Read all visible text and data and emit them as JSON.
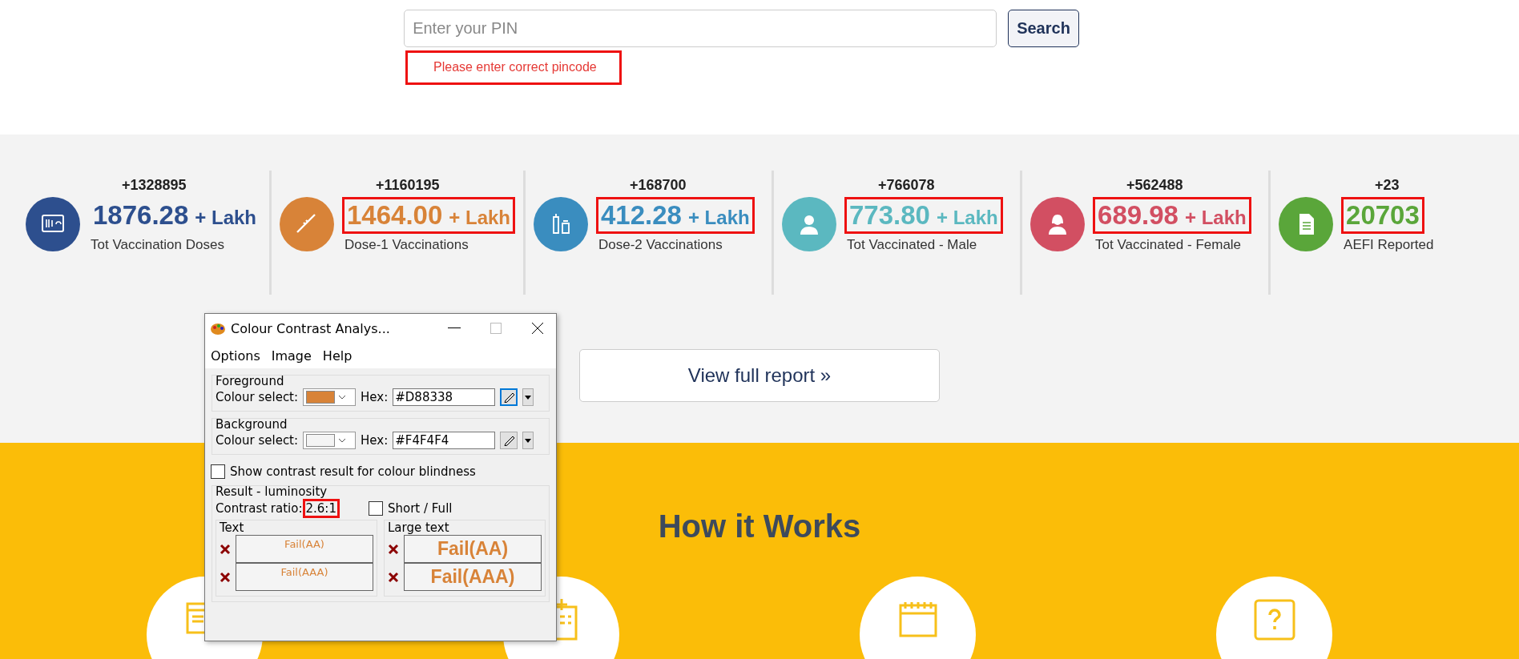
{
  "search": {
    "placeholder": "Enter your PIN",
    "button": "Search",
    "error": "Please enter correct pincode",
    "error_highlighted": true
  },
  "stats": [
    {
      "kind": "doses",
      "color": "#2d4f8e",
      "change": "+1328895",
      "value": "1876.28",
      "unit": "+ Lakh",
      "label": "Tot Vaccination Doses",
      "highlighted": false
    },
    {
      "kind": "syringe",
      "color": "#d88338",
      "change": "+1160195",
      "value": "1464.00",
      "unit": "+ Lakh",
      "label": "Dose-1 Vaccinations",
      "highlighted": true
    },
    {
      "kind": "vials",
      "color": "#3a8dbf",
      "change": "+168700",
      "value": "412.28",
      "unit": "+ Lakh",
      "label": "Dose-2 Vaccinations",
      "highlighted": true
    },
    {
      "kind": "male",
      "color": "#5bb8c0",
      "change": "+766078",
      "value": "773.80",
      "unit": "+ Lakh",
      "label": "Tot Vaccinated - Male",
      "highlighted": true
    },
    {
      "kind": "female",
      "color": "#d24f62",
      "change": "+562488",
      "value": "689.98",
      "unit": "+ Lakh",
      "label": "Tot Vaccinated - Female",
      "highlighted": true
    },
    {
      "kind": "document",
      "color": "#5aa63a",
      "change": "+23",
      "value": "20703",
      "label": "AEFI Reported",
      "highlighted": true
    }
  ],
  "report_button": "View full report »",
  "how_it_works": {
    "title": "How it Works",
    "steps": [
      {
        "kind": "browser"
      },
      {
        "kind": "hospital"
      },
      {
        "kind": "calendar"
      },
      {
        "kind": "question"
      }
    ]
  },
  "dialog": {
    "title": "Colour Contrast Analys...",
    "menu": [
      "Options",
      "Image",
      "Help"
    ],
    "colours": [
      {
        "group": "Foreground",
        "select_label": "Colour select:",
        "color": "#d88338",
        "hex_label": "Hex:",
        "hex": "#D88338",
        "picker_selected": true
      },
      {
        "group": "Background",
        "select_label": "Colour select:",
        "color": "#f4f4f4",
        "hex_label": "Hex:",
        "hex": "#F4F4F4",
        "picker_selected": false
      }
    ],
    "colour_blindness": {
      "label": "Show contrast result for colour blindness",
      "checked": false
    },
    "result_group": "Result - luminosity",
    "ratio_label": "Contrast ratio:",
    "ratio": "2.6:1",
    "ratio_highlighted": true,
    "short_full": {
      "label": "Short / Full",
      "checked": false
    },
    "results": [
      {
        "kind": "text",
        "group": "Text",
        "rows": [
          {
            "text": "Fail(AA)",
            "passed": false
          },
          {
            "text": "Fail(AAA)",
            "passed": false
          }
        ]
      },
      {
        "kind": "large",
        "group": "Large text",
        "rows": [
          {
            "text": "Fail(AA)",
            "passed": false
          },
          {
            "text": "Fail(AAA)",
            "passed": false
          }
        ]
      }
    ]
  }
}
